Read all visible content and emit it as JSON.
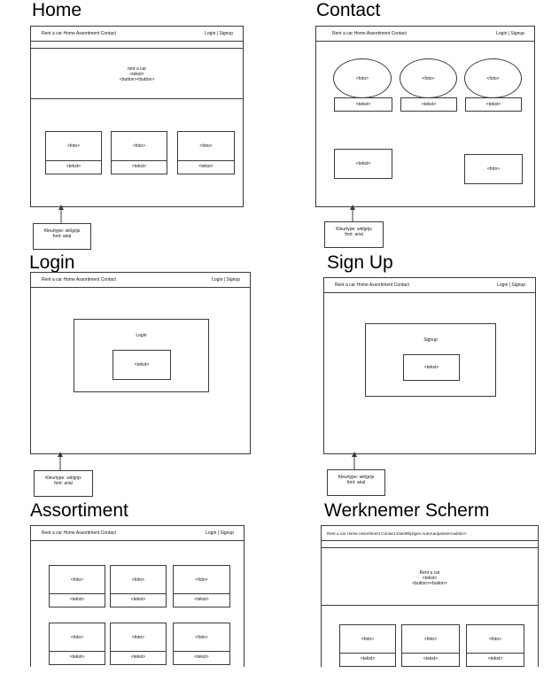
{
  "screens": {
    "home": {
      "title": "Home",
      "nav_left": "Rent a car  Home Assortiment Contact",
      "nav_right": "Login |  Signup",
      "hero": [
        "rent a car",
        "<tekst>",
        "<button><button>"
      ],
      "cards": [
        {
          "foto": "<foto>",
          "tekst": "<tekst>"
        },
        {
          "foto": "<foto>",
          "tekst": "<tekst>"
        },
        {
          "foto": "<foto>",
          "tekst": "<tekst>"
        }
      ],
      "note": [
        "Kleurtype: wit/grijs",
        "font: arial"
      ]
    },
    "contact": {
      "title": "Contact",
      "nav_left": "Rent a car  Home Assortiment Contact",
      "nav_right": "Login |  Signup",
      "ellipses": [
        "<foto>",
        "<foto>",
        "<foto>"
      ],
      "tekst_boxes": [
        "<tekst>",
        "<tekst>",
        "<tekst>"
      ],
      "bottom_left": "<tekst>",
      "bottom_right": "<foto>",
      "note": [
        "Kleurtype: wit/grijs",
        "font: arial"
      ]
    },
    "login": {
      "title": "Login",
      "nav_left": "Rent a car  Home Assortiment Contact",
      "nav_right": "Login |  Signup",
      "panel_title": "Login",
      "inner": "<tekst>",
      "note": [
        "Kleurtype: wit/grijs",
        "font: arial"
      ]
    },
    "signup": {
      "title": "Sign Up",
      "nav_left": "Rent a car  Home Assortiment Contact",
      "nav_right": "Login |  Signup",
      "panel_title": "Signup",
      "inner": "<tekst>",
      "note": [
        "Kleurtype: wit/grijs",
        "font: arial"
      ]
    },
    "assortiment": {
      "title": "Assortiment",
      "nav_left": "Rent a car  Home Assortiment Contact",
      "nav_right": "Login |  Signup",
      "cards": [
        {
          "foto": "<foto>",
          "tekst": "<tekst>"
        },
        {
          "foto": "<foto>",
          "tekst": "<tekst>"
        },
        {
          "foto": "<foto>",
          "tekst": "<tekst>"
        },
        {
          "foto": "<foto>",
          "tekst": "<tekst>"
        },
        {
          "foto": "<foto>",
          "tekst": "<tekst>"
        },
        {
          "foto": "<foto>",
          "tekst": "<tekst>"
        }
      ]
    },
    "werknemer": {
      "title": "Werknemer Scherm",
      "nav": "Rent a car  Home Assortiment Contact KlantWijzigen AutoAanpassen<admin>",
      "hero": [
        "Rent a car",
        "<tekst>",
        "<button><button>"
      ],
      "cards": [
        {
          "foto": "<foto>",
          "tekst": "<tekst>"
        },
        {
          "foto": "<foto>",
          "tekst": "<tekst>"
        },
        {
          "foto": "<foto>",
          "tekst": "<tekst>"
        }
      ]
    }
  },
  "colors": {
    "line": "#3a3a3a",
    "background": "#ffffff"
  }
}
